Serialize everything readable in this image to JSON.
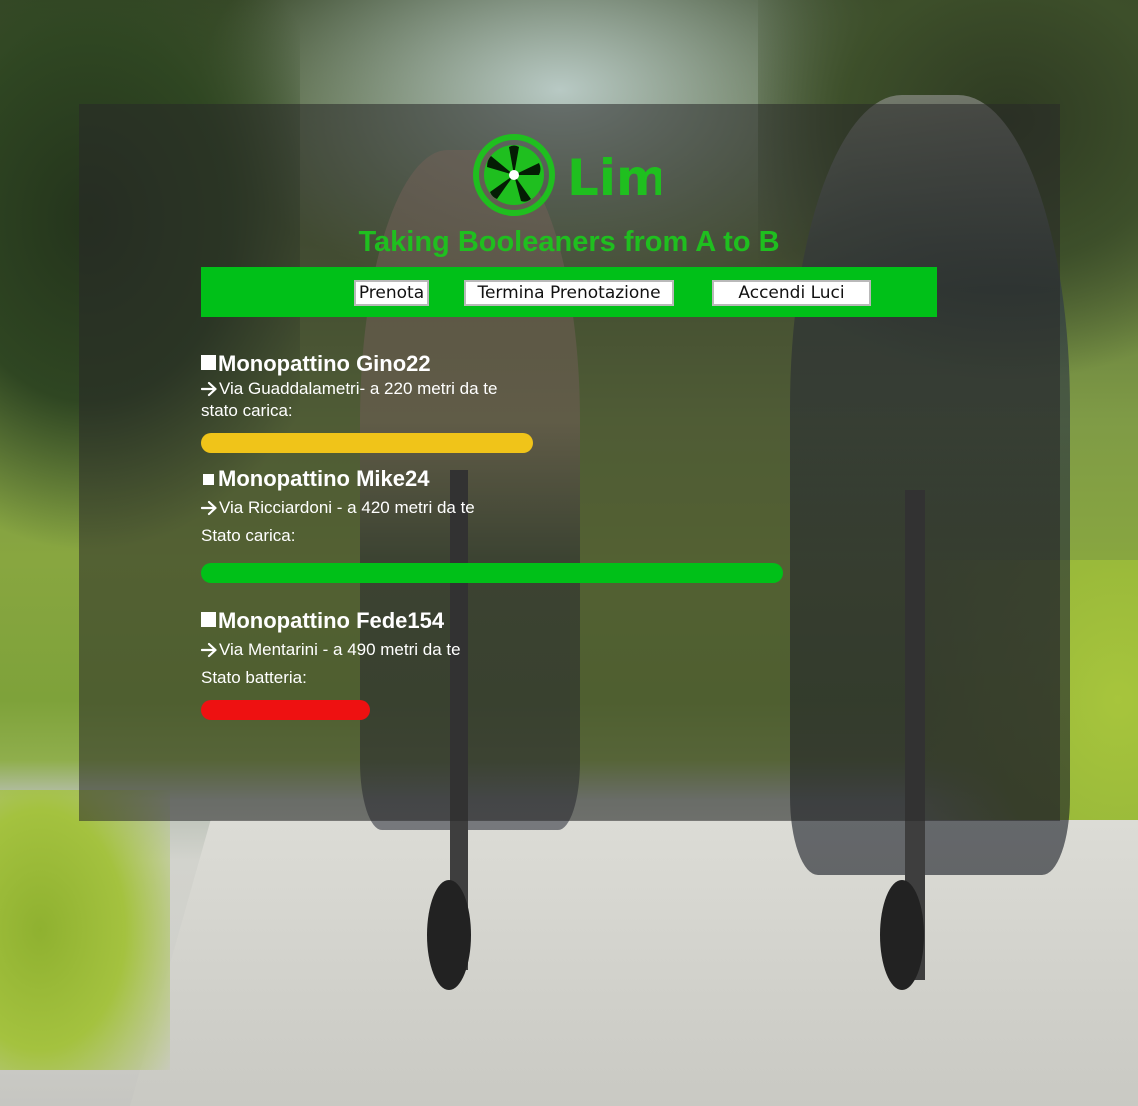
{
  "header": {
    "logo_text": "Lim",
    "tagline": "Taking Booleaners from A to B"
  },
  "nav": {
    "prenota_label": "Prenota",
    "termina_label": "Termina Prenotazione",
    "accendi_label": "Accendi Luci"
  },
  "scooters": [
    {
      "name": "Monopattino Gino22",
      "address": "Via Guaddalametri- a 220 metri da te",
      "status_label": "stato carica:",
      "charge_fraction": 0.57,
      "bar_color": "#f0c419"
    },
    {
      "name": "Monopattino Mike24",
      "address": "Via Ricciardoni - a 420 metri da te",
      "status_label": "Stato carica:",
      "charge_fraction": 1.0,
      "bar_color": "#00c018"
    },
    {
      "name": "Monopattino Fede154",
      "address": "Via Mentarini - a 490 metri da te",
      "status_label": "Stato batteria:",
      "charge_fraction": 0.29,
      "bar_color": "#ee1111"
    }
  ],
  "colors": {
    "brand_green": "#1fbf1f",
    "nav_green": "#00c018"
  },
  "icons": {
    "logo": "lime-wheel-icon",
    "bullet": "square-icon",
    "address": "arrow-right-icon"
  }
}
